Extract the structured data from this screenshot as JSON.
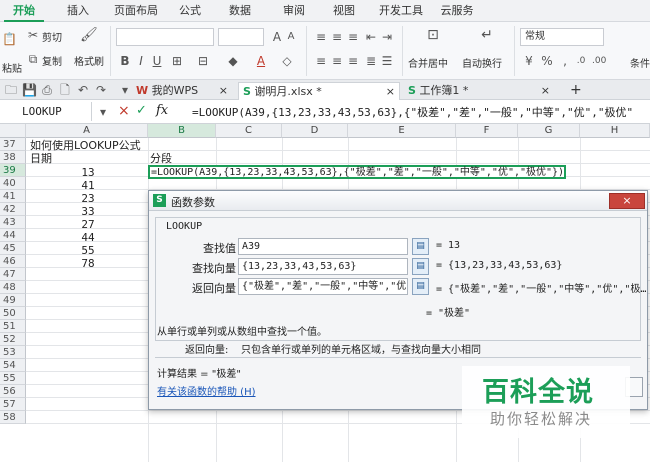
{
  "ribbon_tabs": [
    "开始",
    "插入",
    "页面布局",
    "公式",
    "数据",
    "审阅",
    "视图",
    "开发工具",
    "云服务"
  ],
  "ribbon": {
    "cut": "剪切",
    "copy": "复制",
    "format_painter": "格式刷",
    "paste": "粘贴",
    "merge": "合并居中",
    "autowrap": "自动换行",
    "number_format": "常规",
    "conditional": "条件"
  },
  "doc_tabs": [
    {
      "label": "我的WPS",
      "close": "×"
    },
    {
      "label": "谢明月.xlsx *",
      "close": "×"
    },
    {
      "label": "工作簿1 *",
      "close": "×"
    }
  ],
  "doc_tab_add": "+",
  "formula_bar": {
    "name_box": "LOOKUP",
    "cancel": "×",
    "confirm": "✓",
    "fx": "fx",
    "formula": "=LOOKUP(A39,{13,23,33,43,53,63},{\"极差\",\"差\",\"一般\",\"中等\",\"优\",\"极优\""
  },
  "columns": [
    "A",
    "B",
    "C",
    "D",
    "E",
    "F",
    "G",
    "H"
  ],
  "rows": [
    "37",
    "38",
    "39",
    "40",
    "41",
    "42",
    "43",
    "44",
    "45",
    "46",
    "47",
    "48",
    "49",
    "50",
    "51",
    "52",
    "53",
    "54",
    "55",
    "56",
    "57",
    "58"
  ],
  "cells": {
    "a37": "如何使用LOOKUP公式",
    "a38": "日期",
    "b38": "分段",
    "b39": "=LOOKUP(A39,{13,23,33,43,53,63},{\"极差\",\"差\",\"一般\",\"中等\",\"优\",\"极优\"})",
    "a_values": [
      "13",
      "41",
      "23",
      "33",
      "27",
      "44",
      "55",
      "78"
    ]
  },
  "dialog": {
    "title": "函数参数",
    "close": "×",
    "function_name": "LOOKUP",
    "args": [
      {
        "label": "查找值",
        "value": "A39",
        "result": "= 13"
      },
      {
        "label": "查找向量",
        "value": "{13,23,33,43,53,63}",
        "result": "= {13,23,33,43,53,63}"
      },
      {
        "label": "返回向量",
        "value": "{\"极差\",\"差\",\"一般\",\"中等\",\"优\",\"极",
        "result": "= {\"极差\",\"差\",\"一般\",\"中等\",\"优\",\"极…"
      }
    ],
    "formula_result": "= \"极差\"",
    "description": "从单行或单列或从数组中查找一个值。",
    "arg_help_label": "返回向量:",
    "arg_help_text": "只包含单行或单列的单元格区域，与查找向量大小相同",
    "calc_result": "计算结果 = \"极差\"",
    "help_link": "有关该函数的帮助 (H)"
  },
  "watermark": {
    "title": "百科全说",
    "subtitle": "助你轻松解决"
  },
  "colors": {
    "accent": "#1c9e58",
    "link": "#1a56b8",
    "close": "#c9463d"
  }
}
